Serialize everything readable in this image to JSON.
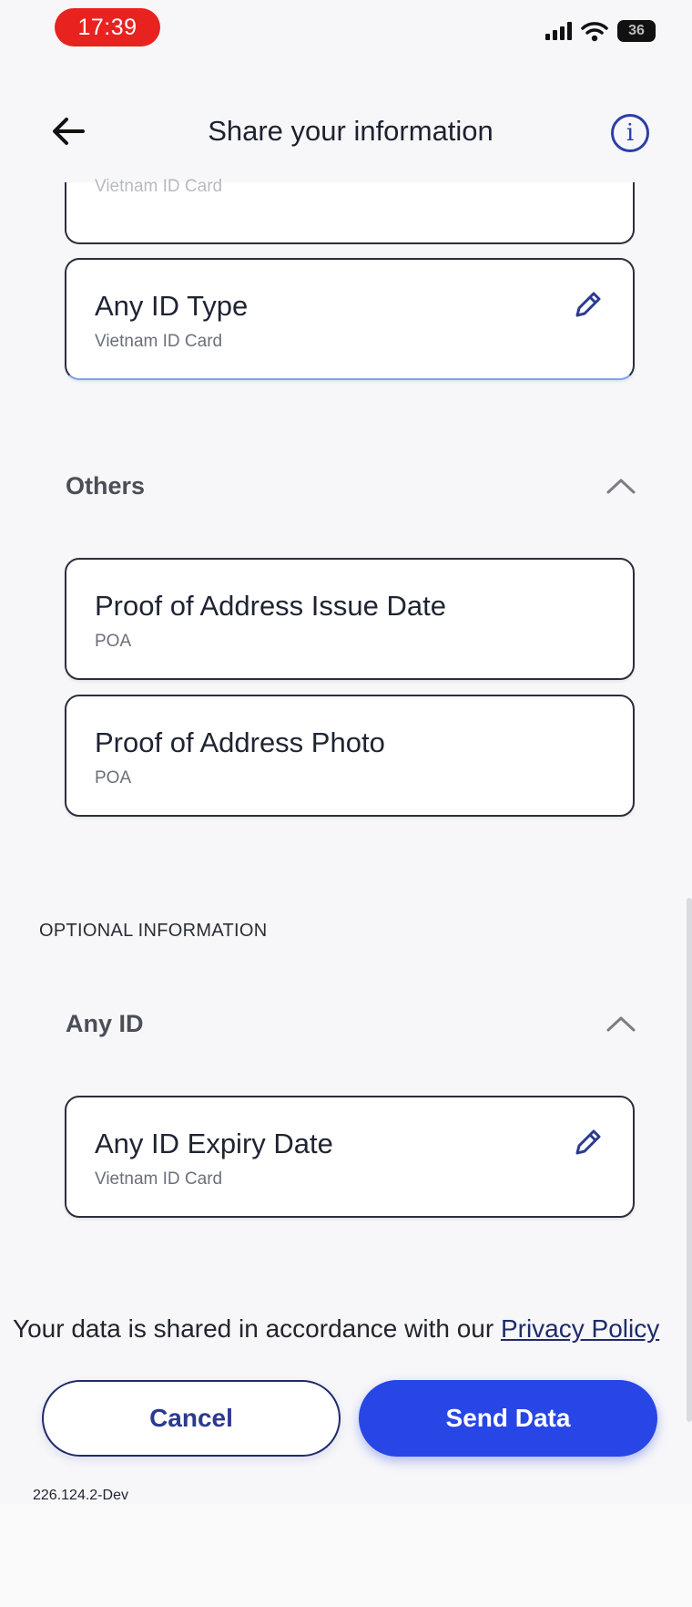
{
  "status_bar": {
    "time": "17:39",
    "battery": "36"
  },
  "header": {
    "title": "Share your information",
    "back_icon": "arrow-left-icon",
    "info_icon": "info-icon",
    "info_glyph": "i"
  },
  "partial_card": {
    "subtitle": "Vietnam ID Card"
  },
  "id_card": {
    "title": "Any ID Type",
    "subtitle": "Vietnam ID Card"
  },
  "others": {
    "title": "Others",
    "items": [
      {
        "title": "Proof of Address Issue Date",
        "subtitle": "POA"
      },
      {
        "title": "Proof of Address Photo",
        "subtitle": "POA"
      }
    ]
  },
  "optional": {
    "label": "OPTIONAL INFORMATION",
    "section_title": "Any ID",
    "items": [
      {
        "title": "Any ID Expiry Date",
        "subtitle": "Vietnam ID Card"
      }
    ]
  },
  "footer": {
    "policy_text": "Your data is shared in accordance with our ",
    "policy_link": "Privacy Policy",
    "cancel_label": "Cancel",
    "send_label": "Send Data",
    "version": "226.124.2-Dev"
  },
  "colors": {
    "primary": "#2746e5",
    "navy": "#1f2b6b",
    "status_red": "#e8231f"
  }
}
